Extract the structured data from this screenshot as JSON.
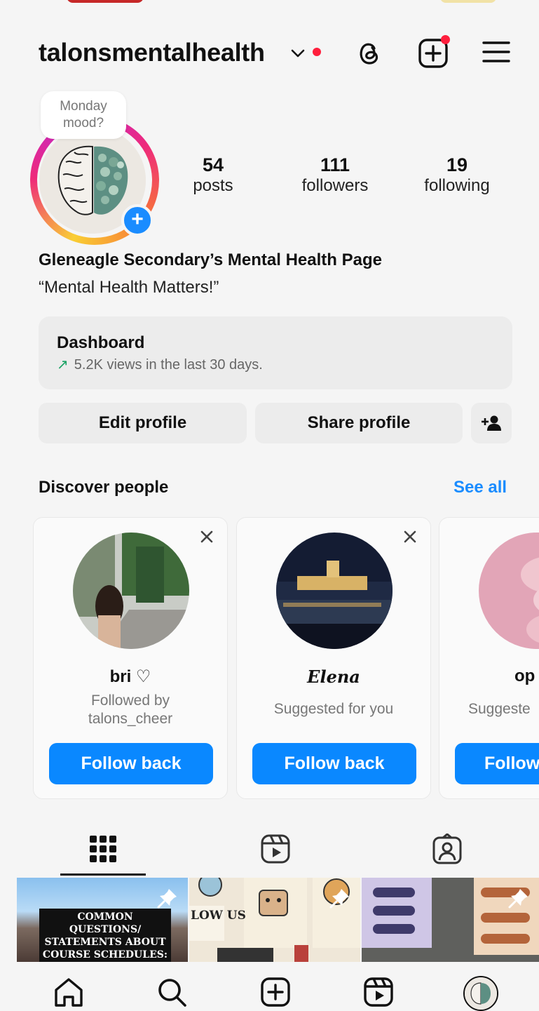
{
  "profile": {
    "username": "talonsmentalhealth",
    "note": "Monday mood?",
    "stats": [
      {
        "value": "54",
        "label": "posts"
      },
      {
        "value": "111",
        "label": "followers"
      },
      {
        "value": "19",
        "label": "following"
      }
    ],
    "bio_name": "Gleneagle Secondary’s Mental Health Page",
    "bio_text": "“Mental Health Matters!”"
  },
  "dashboard": {
    "title": "Dashboard",
    "subtitle": "5.2K views in the last 30 days."
  },
  "actions": {
    "edit_label": "Edit profile",
    "share_label": "Share profile"
  },
  "discover": {
    "title": "Discover people",
    "see_all": "See all",
    "cards": [
      {
        "name": "bri ♡",
        "subtitle": "Followed by talons_cheer",
        "button": "Follow back"
      },
      {
        "name": "Elena",
        "subtitle": "Suggested for you",
        "button": "Follow back"
      },
      {
        "name": "op",
        "subtitle": "Suggeste",
        "button": "Follow"
      }
    ]
  },
  "posts": {
    "first_post_text": "COMMON QUESTIONS/ STATEMENTS ABOUT COURSE SCHEDULES:",
    "second_post_text": "LOW US"
  },
  "colors": {
    "accent_blue": "#0a88ff",
    "notification_red": "#ff1f3d"
  }
}
